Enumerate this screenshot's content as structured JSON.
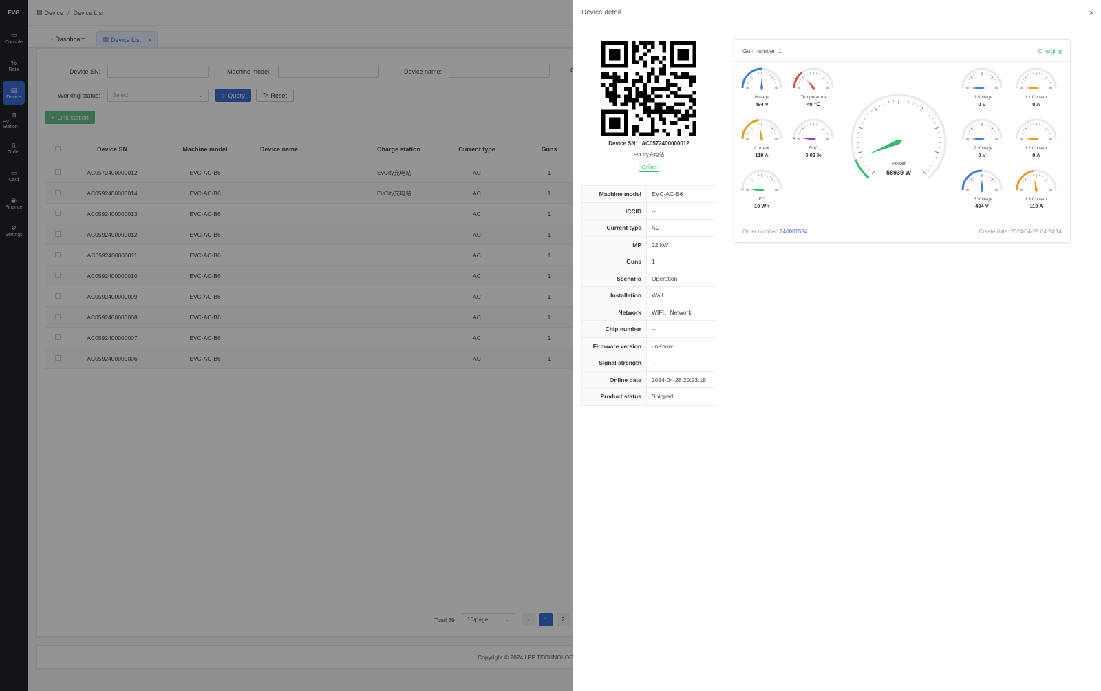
{
  "app": {
    "logo": "EVG"
  },
  "sidebar": {
    "items": [
      {
        "label": "Console",
        "icon": "monitor-icon",
        "glyph": "▭"
      },
      {
        "label": "Rate",
        "icon": "percent-icon",
        "glyph": "%"
      },
      {
        "label": "Device",
        "icon": "device-icon",
        "glyph": "▤",
        "active": true
      },
      {
        "label": "EV Station",
        "icon": "station-icon",
        "glyph": "⊟"
      },
      {
        "label": "Order",
        "icon": "order-icon",
        "glyph": "▯"
      },
      {
        "label": "Card",
        "icon": "card-icon",
        "glyph": "▭"
      },
      {
        "label": "Finance",
        "icon": "finance-icon",
        "glyph": "◉"
      },
      {
        "label": "Settings",
        "icon": "settings-icon",
        "glyph": "⚙"
      }
    ]
  },
  "breadcrumb": {
    "parent": "Device",
    "separator": "/",
    "current": "Device List"
  },
  "tabs": [
    {
      "label": "Dashboard",
      "glyph": "◔"
    },
    {
      "label": "Device List",
      "glyph": "▤",
      "active": true,
      "close": "×"
    }
  ],
  "filters": {
    "device_sn_label": "Device SN:",
    "machine_model_label": "Machine model:",
    "device_name_label": "Device name:",
    "cut_label": "C",
    "working_status_label": "Working status:",
    "working_status_placeholder": "Select",
    "query_label": "Query",
    "reset_label": "Reset",
    "link_station_label": "Link station"
  },
  "table": {
    "columns": [
      "Device SN",
      "Machine model",
      "Device name",
      "Charge station",
      "Current type",
      "Guns"
    ],
    "rows": [
      {
        "sn": "AC0572400000012",
        "model": "EVC-AC-B6",
        "name": "",
        "station": "EvCity充电站",
        "type": "AC",
        "guns": "1"
      },
      {
        "sn": "AC0592400000014",
        "model": "EVC-AC-B6",
        "name": "",
        "station": "EvCity充电站",
        "type": "AC",
        "guns": "1"
      },
      {
        "sn": "AC0592400000013",
        "model": "EVC-AC-B6",
        "name": "",
        "station": "",
        "type": "AC",
        "guns": "1"
      },
      {
        "sn": "AC0592400000012",
        "model": "EVC-AC-B6",
        "name": "",
        "station": "",
        "type": "AC",
        "guns": "1"
      },
      {
        "sn": "AC0592400000011",
        "model": "EVC-AC-B6",
        "name": "",
        "station": "",
        "type": "AC",
        "guns": "1"
      },
      {
        "sn": "AC0592400000010",
        "model": "EVC-AC-B6",
        "name": "",
        "station": "",
        "type": "AC",
        "guns": "1"
      },
      {
        "sn": "AC0592400000009",
        "model": "EVC-AC-B6",
        "name": "",
        "station": "",
        "type": "AC",
        "guns": "1"
      },
      {
        "sn": "AC0592400000008",
        "model": "EVC-AC-B6",
        "name": "",
        "station": "",
        "type": "AC",
        "guns": "1"
      },
      {
        "sn": "AC0592400000007",
        "model": "EVC-AC-B6",
        "name": "",
        "station": "",
        "type": "AC",
        "guns": "1"
      },
      {
        "sn": "AC0592400000006",
        "model": "EVC-AC-B6",
        "name": "",
        "station": "",
        "type": "AC",
        "guns": "1"
      }
    ]
  },
  "pagination": {
    "total": "Total 39",
    "page_size": "10/page",
    "prev": "‹",
    "pages": [
      "1",
      "2"
    ],
    "current": "1"
  },
  "footer": {
    "copyright": "Copyright © 2024 LFF TECHNOLOG"
  },
  "drawer": {
    "title": "Device detail",
    "close": "×",
    "sn_label": "Device SN:",
    "sn_value": "AC0572400000012",
    "station": "EvCity充电站",
    "status_badge": "Online",
    "details": [
      {
        "label": "Machine model",
        "value": "EVC-AC-B6"
      },
      {
        "label": "ICCID",
        "value": "--"
      },
      {
        "label": "Current type",
        "value": "AC"
      },
      {
        "label": "MP",
        "value": "22 kW"
      },
      {
        "label": "Guns",
        "value": "1"
      },
      {
        "label": "Scenario",
        "value": "Operation"
      },
      {
        "label": "Installation",
        "value": "Wall"
      },
      {
        "label": "Network",
        "value": "WIFI、Network"
      },
      {
        "label": "Chip number",
        "value": "--"
      },
      {
        "label": "Firmware version",
        "value": "unKnow"
      },
      {
        "label": "Signal strength",
        "value": "--"
      },
      {
        "label": "Online date",
        "value": "2024-04-28 20:23:18"
      },
      {
        "label": "Product status",
        "value": "Shipped"
      }
    ],
    "card": {
      "gun_number": "Gun number: 1",
      "status": "Charging",
      "order_label": "Order number:",
      "order_number": "240001534",
      "create_date_label": "Create date:",
      "create_date": "2024-04-29 04:24:14",
      "colors": {
        "blue": "#3f7fe0",
        "red": "#e84545",
        "orange": "#f39a1a",
        "purple": "#8a3fe0",
        "green": "#2bbf68"
      },
      "gauges": {
        "voltage": {
          "label": "Voltage",
          "value": "494 V",
          "level": 0.5,
          "color": "blue"
        },
        "temperature": {
          "label": "Temperature",
          "value": "40 ℃",
          "level": 0.3,
          "color": "red"
        },
        "current": {
          "label": "Current",
          "value": "119 A",
          "level": 0.45,
          "color": "orange"
        },
        "soc": {
          "label": "SOC",
          "value": "0.02 %",
          "level": 0.02,
          "color": "purple"
        },
        "ec": {
          "label": "EC",
          "value": "10 Wh",
          "level": 0.01,
          "color": "green"
        },
        "power": {
          "label": "Power",
          "value": "58939 W",
          "level": 0.1,
          "color": "green"
        },
        "l1_voltage": {
          "label": "L1 Voltage",
          "value": "0 V",
          "level": 0,
          "color": "blue"
        },
        "l1_current": {
          "label": "L1 Current",
          "value": "0 A",
          "level": 0,
          "color": "orange"
        },
        "l2_voltage": {
          "label": "L2 Voltage",
          "value": "0 V",
          "level": 0,
          "color": "blue"
        },
        "l2_current": {
          "label": "L2 Current",
          "value": "0 A",
          "level": 0,
          "color": "orange"
        },
        "l3_voltage": {
          "label": "L3 Voltage",
          "value": "494 V",
          "level": 0.5,
          "color": "blue"
        },
        "l3_current": {
          "label": "L3 Current",
          "value": "119 A",
          "level": 0.45,
          "color": "orange"
        }
      }
    }
  }
}
